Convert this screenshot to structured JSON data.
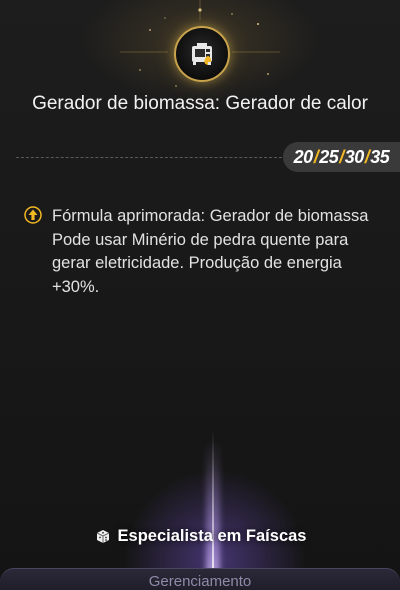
{
  "header": {
    "emblem_icon": "biomass-generator-icon",
    "title": "Gerador de biomassa: Gerador de calor"
  },
  "levels": {
    "values": [
      "20",
      "25",
      "30",
      "35"
    ],
    "separator": "/",
    "separator_color": "#f2b824"
  },
  "effect": {
    "icon": "upgrade-arrow-icon",
    "lines": [
      "Fórmula aprimorada: Gerador de biomassa",
      "Pode usar Minério de pedra quente para gerar eletricidade. Produção de energia +30%."
    ]
  },
  "specialist": {
    "icon": "dice-icon",
    "label": "Especialista em Faíscas"
  },
  "footer_tab": {
    "label": "Gerenciamento"
  },
  "colors": {
    "background": "#171717",
    "accent_gold": "#c8a34c",
    "level_badge_bg": "#3a3a3a",
    "purple_glow": "#8a6ad0"
  }
}
